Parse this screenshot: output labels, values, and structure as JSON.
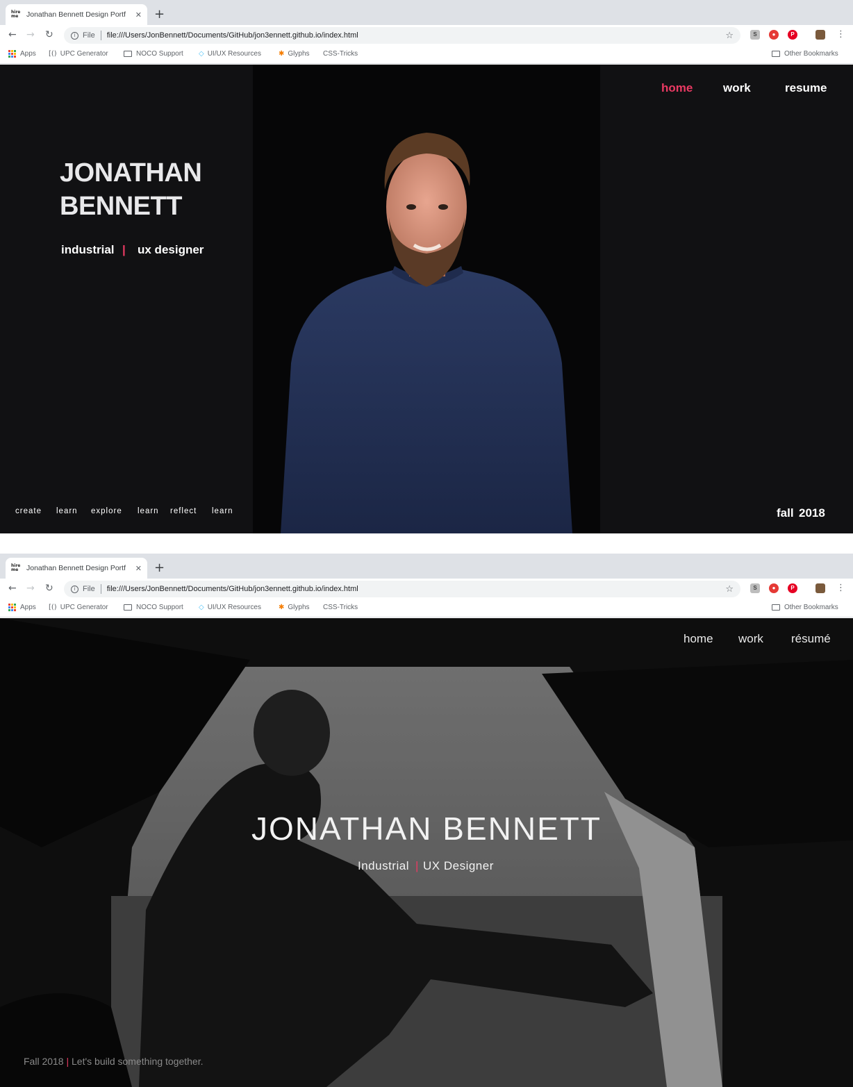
{
  "browser": {
    "tab_title": "Jonathan Bennett Design Portf",
    "favicon_text": "hire me",
    "new_tab": "+",
    "scheme": "File",
    "url": "file:///Users/JonBennett/Documents/GitHub/jon3ennett.github.io/index.html",
    "extensions": [
      "S",
      "●",
      "P"
    ],
    "bookmarks": [
      "Apps",
      "UPC Generator",
      "NOCO Support",
      "UI/UX Resources",
      "Glyphs",
      "CSS-Tricks"
    ],
    "other_bookmarks": "Other Bookmarks"
  },
  "version1": {
    "nav": [
      "home",
      "work",
      "resume"
    ],
    "name_line1": "JONATHAN",
    "name_line2": "BENNETT",
    "role_left": "industrial",
    "role_sep": "|",
    "role_right": "ux designer",
    "tagline": [
      "create",
      "learn",
      "explore",
      "learn",
      "reflect",
      "learn"
    ],
    "season": "fall",
    "year": "2018"
  },
  "version2": {
    "nav": [
      "home",
      "work",
      "résumé"
    ],
    "name": "JONATHAN BENNETT",
    "role_left": "Industrial",
    "role_sep": "|",
    "role_right": "UX Designer",
    "footer_date": "Fall 2018",
    "footer_sep": "|",
    "footer_msg": "Let's build something together."
  },
  "colors": {
    "accent": "#ea3a63",
    "page1_bg": "#111113",
    "chrome_bg": "#dee1e6"
  }
}
